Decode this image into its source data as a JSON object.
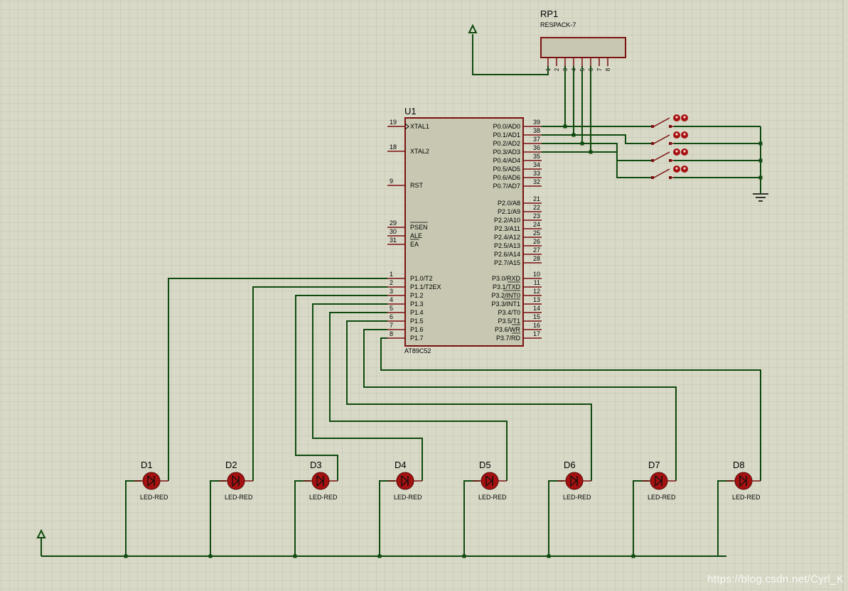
{
  "rp1": {
    "ref": "RP1",
    "type": "RESPACK-7",
    "pins": [
      "1",
      "2",
      "3",
      "4",
      "5",
      "6",
      "7",
      "8"
    ]
  },
  "u1": {
    "ref": "U1",
    "type": "AT89C52",
    "left_pins": [
      {
        "num": "19",
        "name": "XTAL1"
      },
      {
        "num": "18",
        "name": "XTAL2"
      },
      {
        "num": "9",
        "name": "RST"
      },
      {
        "num": "29",
        "name": "PSEN",
        "bar": true
      },
      {
        "num": "30",
        "name": "ALE"
      },
      {
        "num": "31",
        "name": "EA",
        "bar": true
      },
      {
        "num": "1",
        "name": "P1.0/T2"
      },
      {
        "num": "2",
        "name": "P1.1/T2EX"
      },
      {
        "num": "3",
        "name": "P1.2"
      },
      {
        "num": "4",
        "name": "P1.3"
      },
      {
        "num": "5",
        "name": "P1.4"
      },
      {
        "num": "6",
        "name": "P1.5"
      },
      {
        "num": "7",
        "name": "P1.6"
      },
      {
        "num": "8",
        "name": "P1.7"
      }
    ],
    "right_pins": [
      {
        "num": "39",
        "name": "P0.0/AD0"
      },
      {
        "num": "38",
        "name": "P0.1/AD1"
      },
      {
        "num": "37",
        "name": "P0.2/AD2"
      },
      {
        "num": "36",
        "name": "P0.3/AD3"
      },
      {
        "num": "35",
        "name": "P0.4/AD4"
      },
      {
        "num": "34",
        "name": "P0.5/AD5"
      },
      {
        "num": "33",
        "name": "P0.6/AD6"
      },
      {
        "num": "32",
        "name": "P0.7/AD7"
      },
      {
        "num": "21",
        "name": "P2.0/A8"
      },
      {
        "num": "22",
        "name": "P2.1/A9"
      },
      {
        "num": "23",
        "name": "P2.2/A10"
      },
      {
        "num": "24",
        "name": "P2.3/A11"
      },
      {
        "num": "25",
        "name": "P2.4/A12"
      },
      {
        "num": "26",
        "name": "P2.5/A13"
      },
      {
        "num": "27",
        "name": "P2.6/A14"
      },
      {
        "num": "28",
        "name": "P2.7/A15"
      },
      {
        "num": "10",
        "name": "P3.0/RXD"
      },
      {
        "num": "11",
        "name": "P3.1/TXD",
        "bar": "TXD"
      },
      {
        "num": "12",
        "name": "P3.2/INT0",
        "bar": "INT0"
      },
      {
        "num": "13",
        "name": "P3.3/INT1",
        "bar": "INT1"
      },
      {
        "num": "14",
        "name": "P3.4/T0"
      },
      {
        "num": "15",
        "name": "P3.5/T1"
      },
      {
        "num": "16",
        "name": "P3.6/WR",
        "bar": "WR"
      },
      {
        "num": "17",
        "name": "P3.7/RD",
        "bar": "RD"
      }
    ]
  },
  "leds": [
    {
      "ref": "D1",
      "type": "LED-RED"
    },
    {
      "ref": "D2",
      "type": "LED-RED"
    },
    {
      "ref": "D3",
      "type": "LED-RED"
    },
    {
      "ref": "D4",
      "type": "LED-RED"
    },
    {
      "ref": "D5",
      "type": "LED-RED"
    },
    {
      "ref": "D6",
      "type": "LED-RED"
    },
    {
      "ref": "D7",
      "type": "LED-RED"
    },
    {
      "ref": "D8",
      "type": "LED-RED"
    }
  ],
  "watermark": "https://blog.csdn.net/Cyrl_K",
  "colors": {
    "background": "#d9d9c8",
    "grid": "#c3c3b0",
    "wire": "#0f4a0f",
    "outline": "#7a1010",
    "body": "#c8c8b2",
    "led": "#a51010"
  }
}
